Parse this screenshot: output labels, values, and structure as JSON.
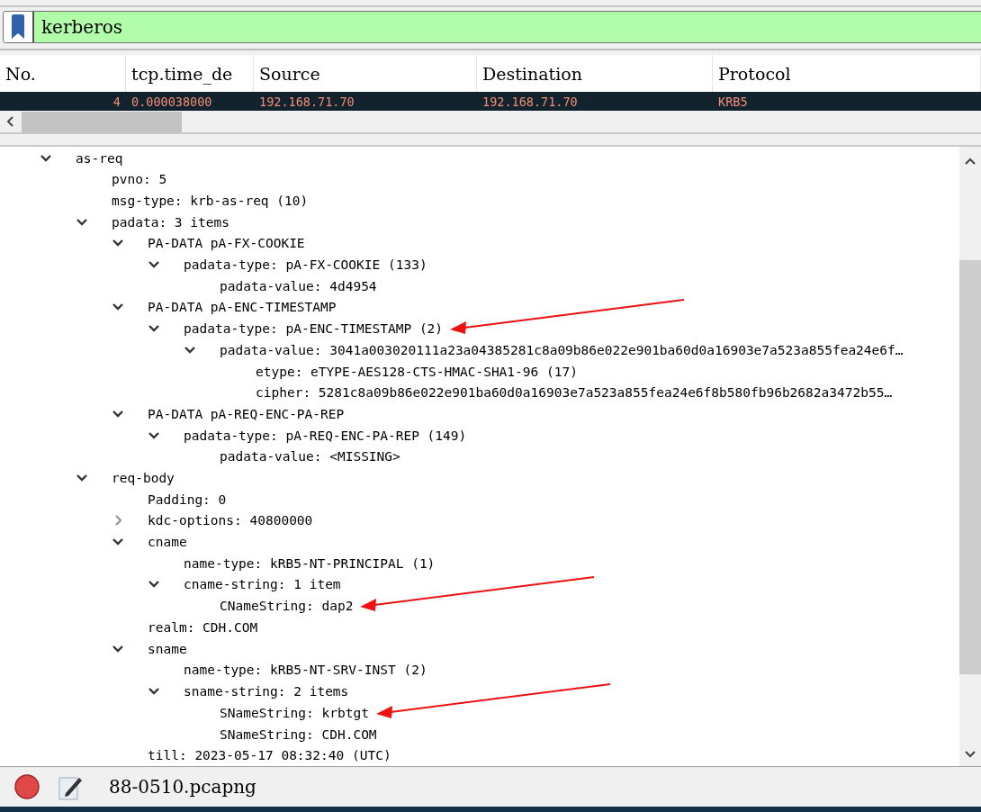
{
  "filter": {
    "value": "kerberos"
  },
  "packet_list": {
    "columns": [
      "No.",
      "tcp.time_de",
      "Source",
      "Destination",
      "Protocol"
    ],
    "rows": [
      {
        "selected": true,
        "cells": [
          "4",
          "0.000038000",
          "192.168.71.70",
          "192.168.71.70",
          "KRB5"
        ]
      }
    ]
  },
  "details": {
    "items": [
      {
        "label": "as-req",
        "expanded": true,
        "children": [
          {
            "label": "pvno: 5"
          },
          {
            "label": "msg-type: krb-as-req (10)"
          },
          {
            "label": "padata: 3 items",
            "expanded": true,
            "children": [
              {
                "label": "PA-DATA pA-FX-COOKIE",
                "expanded": true,
                "children": [
                  {
                    "label": "padata-type: pA-FX-COOKIE (133)",
                    "expanded": true,
                    "children": [
                      {
                        "label": "padata-value: 4d4954"
                      }
                    ]
                  }
                ]
              },
              {
                "label": "PA-DATA pA-ENC-TIMESTAMP",
                "expanded": true,
                "children": [
                  {
                    "label": "padata-type: pA-ENC-TIMESTAMP (2)",
                    "expanded": true,
                    "annotated": true,
                    "children": [
                      {
                        "label": "padata-value: 3041a003020111a23a04385281c8a09b86e022e901ba60d0a16903e7a523a855fea24e6f…",
                        "expanded": true,
                        "children": [
                          {
                            "label": "etype: eTYPE-AES128-CTS-HMAC-SHA1-96 (17)"
                          },
                          {
                            "label": "cipher: 5281c8a09b86e022e901ba60d0a16903e7a523a855fea24e6f8b580fb96b2682a3472b55…"
                          }
                        ]
                      }
                    ]
                  }
                ]
              },
              {
                "label": "PA-DATA pA-REQ-ENC-PA-REP",
                "expanded": true,
                "children": [
                  {
                    "label": "padata-type: pA-REQ-ENC-PA-REP (149)",
                    "expanded": true,
                    "children": [
                      {
                        "label": "padata-value: <MISSING>"
                      }
                    ]
                  }
                ]
              }
            ]
          },
          {
            "label": "req-body",
            "expanded": true,
            "children": [
              {
                "label": "Padding: 0"
              },
              {
                "label": "kdc-options: 40800000",
                "expanded": false
              },
              {
                "label": "cname",
                "expanded": true,
                "children": [
                  {
                    "label": "name-type: kRB5-NT-PRINCIPAL (1)"
                  },
                  {
                    "label": "cname-string: 1 item",
                    "expanded": true,
                    "children": [
                      {
                        "label": "CNameString: dap2",
                        "annotated": true
                      }
                    ]
                  }
                ]
              },
              {
                "label": "realm: CDH.COM"
              },
              {
                "label": "sname",
                "expanded": true,
                "children": [
                  {
                    "label": "name-type: kRB5-NT-SRV-INST (2)"
                  },
                  {
                    "label": "sname-string: 2 items",
                    "expanded": true,
                    "children": [
                      {
                        "label": "SNameString: krbtgt",
                        "annotated": true
                      },
                      {
                        "label": "SNameString: CDH.COM"
                      }
                    ]
                  }
                ]
              },
              {
                "label": "till: 2023-05-17 08:32:40 (UTC)"
              }
            ]
          }
        ]
      }
    ]
  },
  "status_bar": {
    "file": "88-0510.pcapng"
  }
}
